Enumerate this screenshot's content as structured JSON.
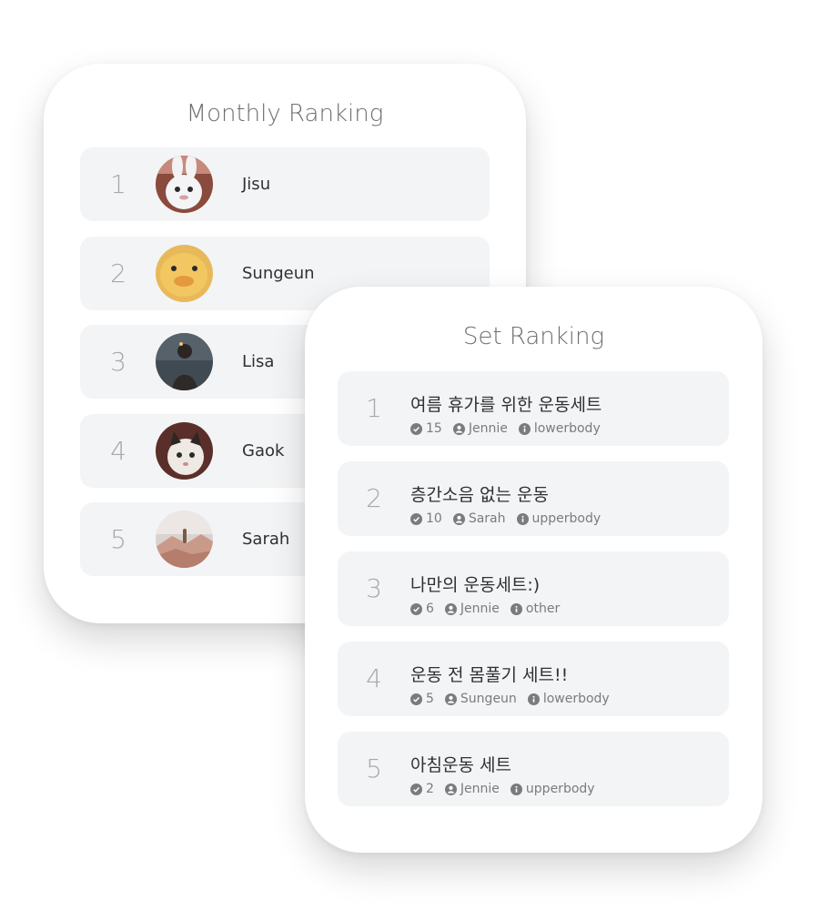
{
  "monthly": {
    "title": "Monthly Ranking",
    "items": [
      {
        "rank": "1",
        "name": "Jisu",
        "avatar": "rabbit-avatar"
      },
      {
        "rank": "2",
        "name": "Sungeun",
        "avatar": "duck-avatar"
      },
      {
        "rank": "3",
        "name": "Lisa",
        "avatar": "person-dark-avatar"
      },
      {
        "rank": "4",
        "name": "Gaok",
        "avatar": "cat-avatar"
      },
      {
        "rank": "5",
        "name": "Sarah",
        "avatar": "landscape-avatar"
      }
    ]
  },
  "sets": {
    "title": "Set Ranking",
    "items": [
      {
        "rank": "1",
        "title": "여름 휴가를 위한 운동세트",
        "count": "15",
        "author": "Jennie",
        "category": "lowerbody"
      },
      {
        "rank": "2",
        "title": "층간소음 없는 운동",
        "count": "10",
        "author": "Sarah",
        "category": "upperbody"
      },
      {
        "rank": "3",
        "title": "나만의 운동세트:)",
        "count": "6",
        "author": "Jennie",
        "category": "other"
      },
      {
        "rank": "4",
        "title": "운동 전 몸풀기 세트!!",
        "count": "5",
        "author": "Sungeun",
        "category": "lowerbody"
      },
      {
        "rank": "5",
        "title": "아침운동 세트",
        "count": "2",
        "author": "Jennie",
        "category": "upperbody"
      }
    ]
  },
  "icons": {
    "count": "check-circle-icon",
    "author": "user-circle-icon",
    "category": "info-circle-icon"
  },
  "colors": {
    "row_bg": "#f3f4f6",
    "rank_text": "#a7a8ab",
    "meta_text": "#7a7b7f",
    "title_text": "#6e6f72"
  }
}
